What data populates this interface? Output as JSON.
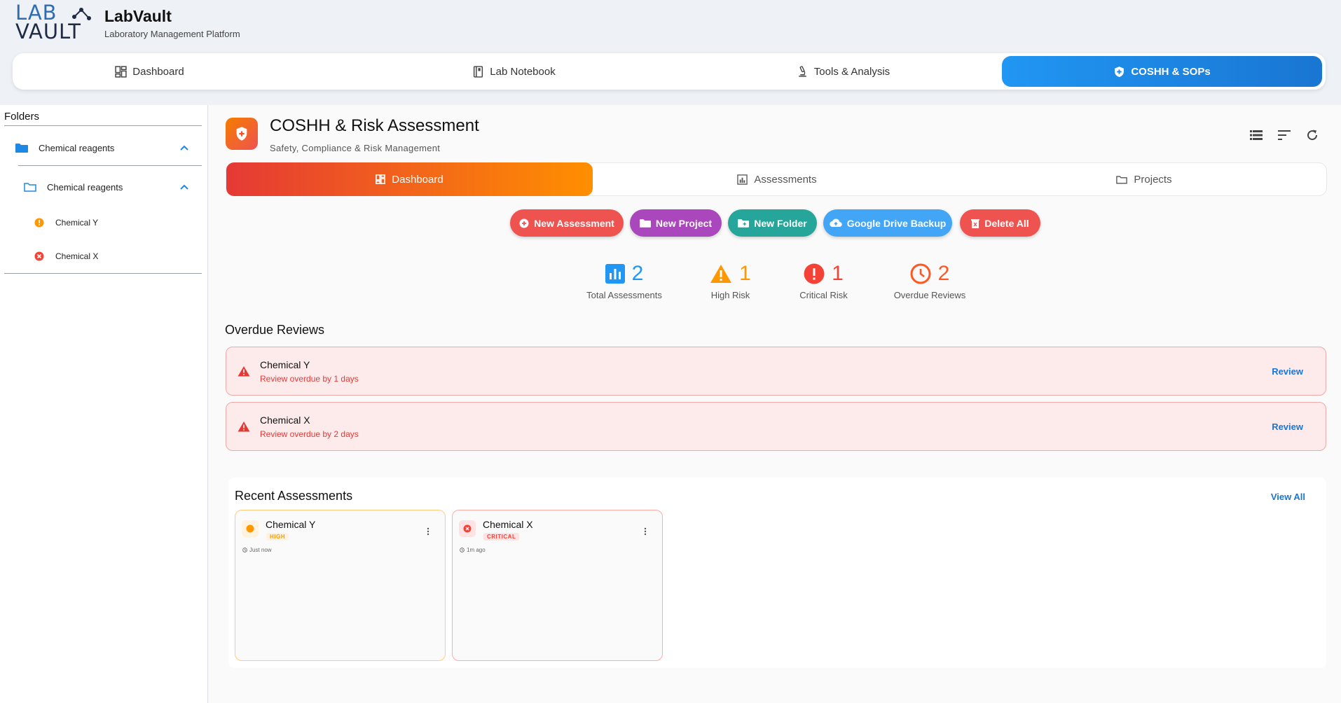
{
  "app": {
    "logo_line1": "LAB",
    "logo_line2": "VAULT",
    "title": "LabVault",
    "subtitle": "Laboratory Management Platform"
  },
  "nav": {
    "items": [
      {
        "label": "Dashboard",
        "icon": "dashboard-icon"
      },
      {
        "label": "Lab Notebook",
        "icon": "notebook-icon"
      },
      {
        "label": "Tools & Analysis",
        "icon": "microscope-icon"
      },
      {
        "label": "COSHH & SOPs",
        "icon": "shield-icon",
        "active": true
      }
    ]
  },
  "sidebar": {
    "title": "Folders",
    "folder": "Chemical reagents",
    "subfolder": "Chemical reagents",
    "items": [
      {
        "label": "Chemical Y",
        "status": "high"
      },
      {
        "label": "Chemical X",
        "status": "critical"
      }
    ]
  },
  "page": {
    "title": "COSHH & Risk Assessment",
    "subtitle": "Safety, Compliance & Risk Management",
    "toolbar_icons": [
      "list-view-icon",
      "sort-icon",
      "refresh-icon"
    ]
  },
  "tabs": [
    {
      "label": "Dashboard",
      "active": true
    },
    {
      "label": "Assessments"
    },
    {
      "label": "Projects"
    }
  ],
  "actions": [
    {
      "label": "New Assessment",
      "color": "#ef5350"
    },
    {
      "label": "New Project",
      "color": "#ab47bc"
    },
    {
      "label": "New Folder",
      "color": "#26a69a"
    },
    {
      "label": "Google Drive Backup",
      "color": "#42a5f5"
    },
    {
      "label": "Delete All",
      "color": "#ef5350"
    }
  ],
  "stats": [
    {
      "value": "2",
      "label": "Total Assessments",
      "color": "#2196f3"
    },
    {
      "value": "1",
      "label": "High Risk",
      "color": "#ff9800"
    },
    {
      "value": "1",
      "label": "Critical Risk",
      "color": "#f44336"
    },
    {
      "value": "2",
      "label": "Overdue Reviews",
      "color": "#ff5722"
    }
  ],
  "overdue": {
    "title": "Overdue Reviews",
    "items": [
      {
        "name": "Chemical Y",
        "note": "Review overdue by 1 days",
        "action": "Review"
      },
      {
        "name": "Chemical X",
        "note": "Review overdue by 2 days",
        "action": "Review"
      }
    ]
  },
  "recent": {
    "title": "Recent Assessments",
    "view_all": "View All",
    "items": [
      {
        "name": "Chemical Y",
        "level": "HIGH",
        "time": "Just now",
        "color": "#ff9800"
      },
      {
        "name": "Chemical X",
        "level": "CRITICAL",
        "time": "1m ago",
        "color": "#f44336"
      }
    ]
  }
}
